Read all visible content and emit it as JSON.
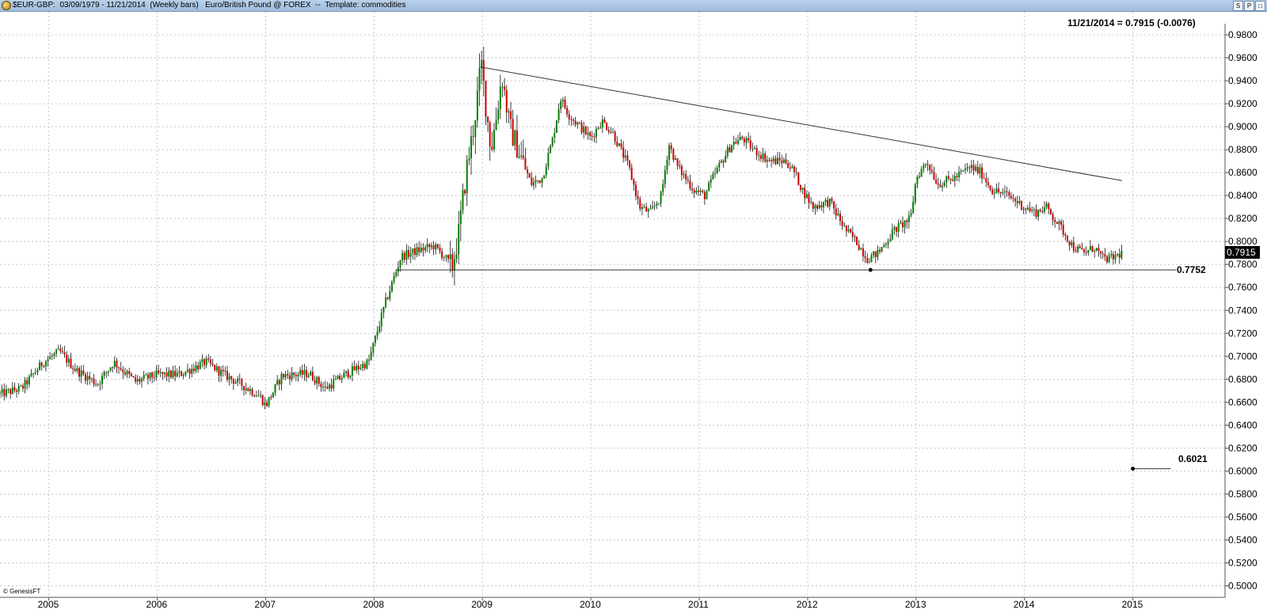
{
  "window": {
    "title": "$EUR-GBP:  03/09/1979 - 11/21/2014  (Weekly bars)   Euro/British Pound @ FOREX  --  Template: commodities",
    "buttons": [
      "S",
      "P",
      "□"
    ]
  },
  "chart_data": {
    "type": "candlestick",
    "symbol": "$EUR-GBP",
    "description": "Euro/British Pound @ FOREX",
    "bar_interval": "Weekly bars",
    "x_range": [
      2004.55,
      2015.85
    ],
    "ylim": [
      0.49,
      1.0
    ],
    "x_ticks": [
      {
        "year": 2005.0,
        "label": "2005"
      },
      {
        "year": 2006.0,
        "label": "2006"
      },
      {
        "year": 2007.0,
        "label": "2007"
      },
      {
        "year": 2008.0,
        "label": "2008"
      },
      {
        "year": 2009.0,
        "label": "2009"
      },
      {
        "year": 2010.0,
        "label": "2010"
      },
      {
        "year": 2011.0,
        "label": "2011"
      },
      {
        "year": 2012.0,
        "label": "2012"
      },
      {
        "year": 2013.0,
        "label": "2013"
      },
      {
        "year": 2014.0,
        "label": "2014"
      },
      {
        "year": 2015.0,
        "label": "2015"
      }
    ],
    "y_ticks": [
      "0.5000",
      "0.5200",
      "0.5400",
      "0.5600",
      "0.5800",
      "0.6000",
      "0.6200",
      "0.6400",
      "0.6600",
      "0.6800",
      "0.7000",
      "0.7200",
      "0.7400",
      "0.7600",
      "0.7800",
      "0.8000",
      "0.8200",
      "0.8400",
      "0.8600",
      "0.8800",
      "0.9000",
      "0.9200",
      "0.9400",
      "0.9600",
      "0.9800"
    ],
    "grid": true,
    "up_color": "#008000",
    "down_color": "#cc0000",
    "anchor_points": [
      [
        2004.55,
        0.667
      ],
      [
        2004.75,
        0.672
      ],
      [
        2004.95,
        0.695
      ],
      [
        2005.1,
        0.704
      ],
      [
        2005.25,
        0.688
      ],
      [
        2005.45,
        0.676
      ],
      [
        2005.6,
        0.695
      ],
      [
        2005.8,
        0.678
      ],
      [
        2006.0,
        0.684
      ],
      [
        2006.2,
        0.684
      ],
      [
        2006.45,
        0.695
      ],
      [
        2006.6,
        0.685
      ],
      [
        2006.8,
        0.674
      ],
      [
        2006.95,
        0.665
      ],
      [
        2007.0,
        0.657
      ],
      [
        2007.15,
        0.683
      ],
      [
        2007.4,
        0.685
      ],
      [
        2007.55,
        0.672
      ],
      [
        2007.75,
        0.685
      ],
      [
        2007.95,
        0.695
      ],
      [
        2008.1,
        0.745
      ],
      [
        2008.25,
        0.787
      ],
      [
        2008.4,
        0.792
      ],
      [
        2008.55,
        0.796
      ],
      [
        2008.65,
        0.787
      ],
      [
        2008.72,
        0.777
      ],
      [
        2008.78,
        0.806
      ],
      [
        2008.85,
        0.86
      ],
      [
        2008.92,
        0.9
      ],
      [
        2008.99,
        0.955
      ],
      [
        2009.03,
        0.92
      ],
      [
        2009.08,
        0.88
      ],
      [
        2009.13,
        0.91
      ],
      [
        2009.18,
        0.945
      ],
      [
        2009.25,
        0.9
      ],
      [
        2009.35,
        0.875
      ],
      [
        2009.45,
        0.85
      ],
      [
        2009.55,
        0.855
      ],
      [
        2009.65,
        0.89
      ],
      [
        2009.72,
        0.925
      ],
      [
        2009.8,
        0.91
      ],
      [
        2009.95,
        0.895
      ],
      [
        2010.0,
        0.89
      ],
      [
        2010.1,
        0.905
      ],
      [
        2010.2,
        0.895
      ],
      [
        2010.35,
        0.865
      ],
      [
        2010.45,
        0.83
      ],
      [
        2010.55,
        0.825
      ],
      [
        2010.65,
        0.84
      ],
      [
        2010.72,
        0.885
      ],
      [
        2010.8,
        0.865
      ],
      [
        2010.95,
        0.845
      ],
      [
        2011.05,
        0.84
      ],
      [
        2011.15,
        0.86
      ],
      [
        2011.3,
        0.885
      ],
      [
        2011.4,
        0.89
      ],
      [
        2011.5,
        0.88
      ],
      [
        2011.65,
        0.87
      ],
      [
        2011.8,
        0.87
      ],
      [
        2011.88,
        0.86
      ],
      [
        2011.95,
        0.845
      ],
      [
        2012.05,
        0.83
      ],
      [
        2012.2,
        0.835
      ],
      [
        2012.35,
        0.81
      ],
      [
        2012.45,
        0.8
      ],
      [
        2012.55,
        0.785
      ],
      [
        2012.65,
        0.79
      ],
      [
        2012.8,
        0.81
      ],
      [
        2012.95,
        0.82
      ],
      [
        2013.0,
        0.855
      ],
      [
        2013.1,
        0.87
      ],
      [
        2013.2,
        0.85
      ],
      [
        2013.35,
        0.855
      ],
      [
        2013.5,
        0.865
      ],
      [
        2013.6,
        0.86
      ],
      [
        2013.7,
        0.845
      ],
      [
        2013.85,
        0.84
      ],
      [
        2014.0,
        0.83
      ],
      [
        2014.1,
        0.825
      ],
      [
        2014.2,
        0.83
      ],
      [
        2014.35,
        0.81
      ],
      [
        2014.45,
        0.795
      ],
      [
        2014.55,
        0.79
      ],
      [
        2014.65,
        0.795
      ],
      [
        2014.72,
        0.785
      ],
      [
        2014.8,
        0.785
      ],
      [
        2014.9,
        0.79
      ]
    ],
    "lines": [
      {
        "kind": "trendline",
        "from": [
          2008.98,
          0.952
        ],
        "to": [
          2014.9,
          0.853
        ]
      },
      {
        "kind": "support",
        "from": [
          2008.2,
          0.7752
        ],
        "to": [
          2015.4,
          0.7752
        ],
        "label": "0.7752"
      },
      {
        "kind": "projection-target",
        "from": [
          2015.0,
          0.6021
        ],
        "to": [
          2015.35,
          0.6021
        ],
        "label": "0.6021"
      }
    ],
    "markers": [
      {
        "x": 2012.58,
        "y": 0.7752
      },
      {
        "x": 2015.0,
        "y": 0.6021
      }
    ],
    "last_price": "0.7915",
    "header_readout": "11/21/2014 = 0.7915 (-0.0076)",
    "footer_credit": "© GenesisFT"
  }
}
